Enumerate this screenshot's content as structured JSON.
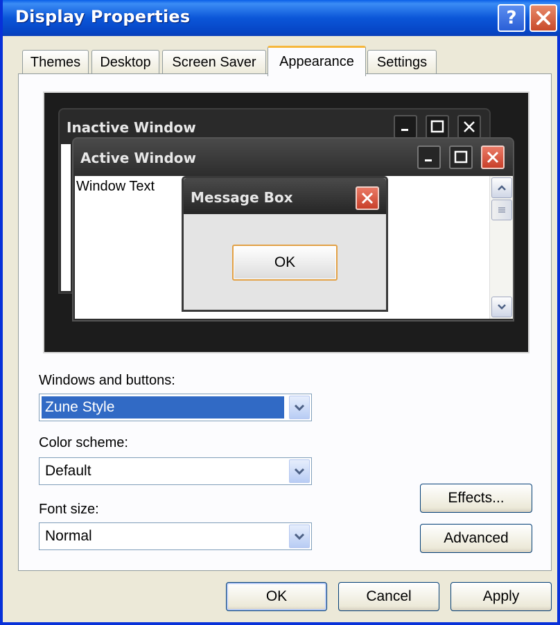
{
  "window": {
    "title": "Display Properties"
  },
  "title_buttons": {
    "help": "?",
    "close": "×"
  },
  "tabs": [
    {
      "label": "Themes"
    },
    {
      "label": "Desktop"
    },
    {
      "label": "Screen Saver"
    },
    {
      "label": "Appearance",
      "active": true
    },
    {
      "label": "Settings"
    }
  ],
  "preview": {
    "inactive_title": "Inactive Window",
    "active_title": "Active Window",
    "window_text": "Window Text",
    "message_title": "Message Box",
    "message_ok": "OK"
  },
  "form": {
    "windows_buttons_label": "Windows and buttons:",
    "windows_buttons_value": "Zune Style",
    "color_scheme_label": "Color scheme:",
    "color_scheme_value": "Default",
    "font_size_label": "Font size:",
    "font_size_value": "Normal"
  },
  "side_buttons": {
    "effects": "Effects...",
    "advanced": "Advanced"
  },
  "footer": {
    "ok": "OK",
    "cancel": "Cancel",
    "apply": "Apply"
  },
  "colors": {
    "titlebar": "#0b56d8",
    "selection": "#316ac5",
    "dialog_bg": "#ece9d8",
    "focus_accent": "#f6b73c"
  }
}
